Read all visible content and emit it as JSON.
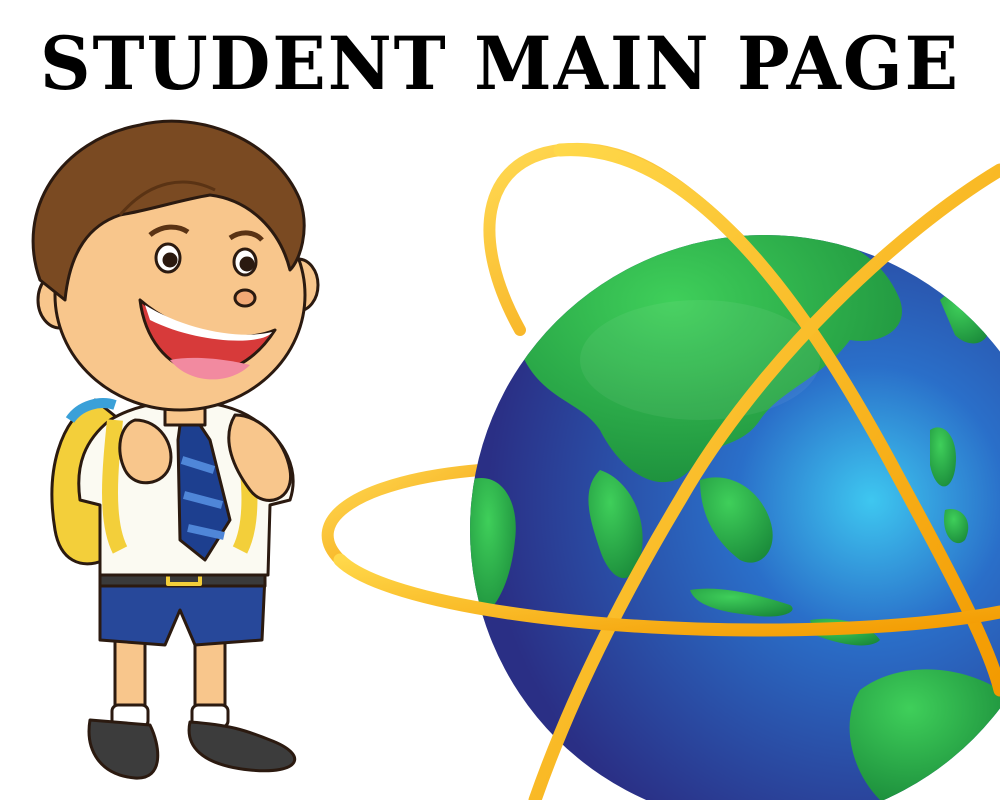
{
  "page": {
    "title": "STUDENT MAIN PAGE"
  },
  "illustrations": {
    "student": "student-boy-with-backpack",
    "globe": "earth-globe-with-orbits"
  },
  "colors": {
    "background": "#ffffff",
    "title": "#000000",
    "ocean": "#2a3f9a",
    "land": "#2aa84a",
    "orbit": "#f7b500",
    "backpack": "#f3cf3a",
    "shorts": "#27489a",
    "tie_dark": "#1d3f8f",
    "tie_light": "#4f86d8",
    "hair": "#7a4a22",
    "skin": "#f8c68c",
    "shoes": "#3c3c3c"
  }
}
